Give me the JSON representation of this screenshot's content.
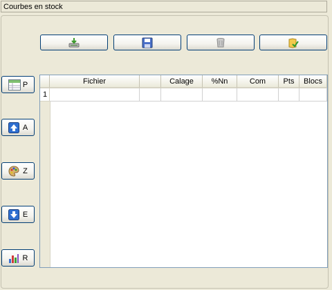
{
  "window": {
    "title": "Courbes en stock"
  },
  "toolbar": {
    "buttons": [
      {
        "icon": "import-tray-icon"
      },
      {
        "icon": "floppy-disk-icon"
      },
      {
        "icon": "trash-can-icon"
      },
      {
        "icon": "folder-check-icon"
      }
    ]
  },
  "side": {
    "buttons": [
      {
        "label": "P",
        "icon": "table-icon"
      },
      {
        "label": "A",
        "icon": "arrow-up-icon"
      },
      {
        "label": "Z",
        "icon": "palette-icon"
      },
      {
        "label": "E",
        "icon": "arrow-down-icon"
      },
      {
        "label": "R",
        "icon": "bar-chart-icon"
      }
    ]
  },
  "table": {
    "columns": [
      "Fichier",
      "",
      "Calage",
      "%Nn",
      "Com",
      "Pts",
      "Blocs"
    ],
    "rows": [
      {
        "num": "1",
        "cells": [
          "",
          "",
          "",
          "",
          "",
          "",
          ""
        ]
      }
    ]
  }
}
